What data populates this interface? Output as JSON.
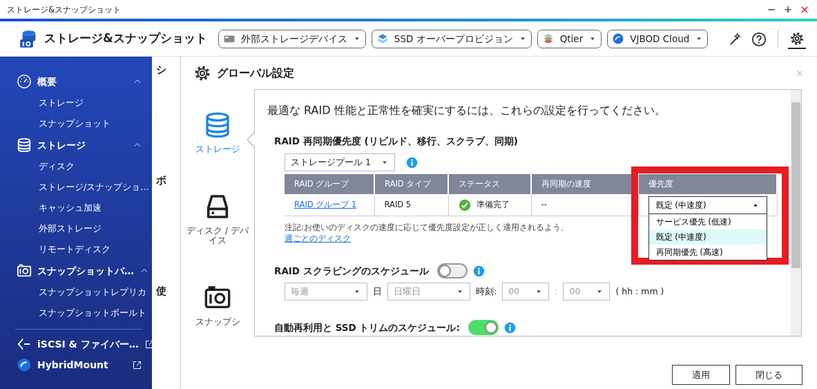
{
  "window": {
    "title": "ストレージ&スナップショット",
    "controls": [
      {
        "kind": "minimize"
      },
      {
        "kind": "maximize"
      },
      {
        "kind": "close"
      }
    ]
  },
  "header": {
    "app_title": "ストレージ&スナップショット",
    "menus": [
      {
        "label": "外部ストレージデバイス"
      },
      {
        "label": "SSD オーバープロビジョン"
      },
      {
        "label": "Qtier"
      },
      {
        "label": "VJBOD Cloud"
      }
    ],
    "tools": [
      {
        "kind": "wand",
        "selected": false
      },
      {
        "kind": "help",
        "selected": false
      },
      {
        "kind": "settings",
        "selected": true
      }
    ]
  },
  "sidebar": {
    "groups": [
      {
        "label": "概要",
        "expanded": true,
        "children": [
          {
            "label": "ストレージ"
          },
          {
            "label": "スナップショット"
          }
        ]
      },
      {
        "label": "ストレージ",
        "expanded": true,
        "children": [
          {
            "label": "ディスク"
          },
          {
            "label": "ストレージ/スナップショ…"
          },
          {
            "label": "キャッシュ加速"
          },
          {
            "label": "外部ストレージ"
          },
          {
            "label": "リモートディスク"
          }
        ]
      },
      {
        "label": "スナップショットバ…",
        "expanded": true,
        "children": [
          {
            "label": "スナップショットレプリカ"
          },
          {
            "label": "スナップショットボールト"
          }
        ]
      }
    ],
    "links": [
      {
        "label": "iSCSI & ファイバー…",
        "external": true
      },
      {
        "label": "HybridMount",
        "external": true
      }
    ]
  },
  "background_page": {
    "fragments": [
      "シ",
      "ボ",
      "使"
    ]
  },
  "dialog": {
    "title": "グローバル設定",
    "tabs": [
      {
        "label": "ストレージ",
        "selected": true
      },
      {
        "label": "ディスク / デバイス",
        "selected": false
      },
      {
        "label": "スナップシ",
        "selected": false
      }
    ],
    "description": "最適な RAID 性能と正常性を確実にするには、これらの設定を行ってください。",
    "resync": {
      "title": "RAID 再同期優先度 (リビルド、移行、スクラブ、同期)",
      "pool_select": {
        "value": "ストレージプール 1"
      },
      "table": {
        "columns": [
          {
            "label": "RAID グループ",
            "highlighted": false
          },
          {
            "label": "RAID タイプ",
            "highlighted": false
          },
          {
            "label": "ステータス",
            "highlighted": false
          },
          {
            "label": "再同期の速度",
            "highlighted": false
          },
          {
            "label": "優先度",
            "highlighted": true
          }
        ],
        "rows": [
          {
            "group": "RAID グループ 1",
            "type": "RAID 5",
            "status": "準備完了",
            "speed": "--",
            "priority": {
              "value": "既定 (中速度)",
              "expanded": true,
              "options": [
                {
                  "label": "サービス優先 (低速)",
                  "selected": false
                },
                {
                  "label": "既定 (中速度)",
                  "selected": true
                },
                {
                  "label": "再同期優先 (高速)",
                  "selected": false
                }
              ]
            }
          }
        ]
      },
      "note": {
        "text": "注記:お使いのディスクの速度に応じて優先度設定が正しく適用されるよう、",
        "link": "週ごとのディスク"
      }
    },
    "scrubbing": {
      "title": "RAID スクラビングのスケジュール",
      "on": false,
      "schedule": [
        {
          "kind": "select",
          "value": "毎週",
          "disabled": true
        },
        {
          "kind": "label",
          "text": "日"
        },
        {
          "kind": "select",
          "value": "日曜日",
          "disabled": true
        },
        {
          "kind": "label",
          "text": "時刻:"
        },
        {
          "kind": "select",
          "value": "00",
          "disabled": true
        },
        {
          "kind": "separator",
          "text": ":"
        },
        {
          "kind": "select",
          "value": "00",
          "disabled": true
        },
        {
          "kind": "label",
          "text": "( hh : mm )"
        }
      ]
    },
    "ssd_trim": {
      "title": "自動再利用と SSD トリムのスケジュール:",
      "on": true
    },
    "buttons": [
      "適用",
      "閉じる"
    ]
  }
}
